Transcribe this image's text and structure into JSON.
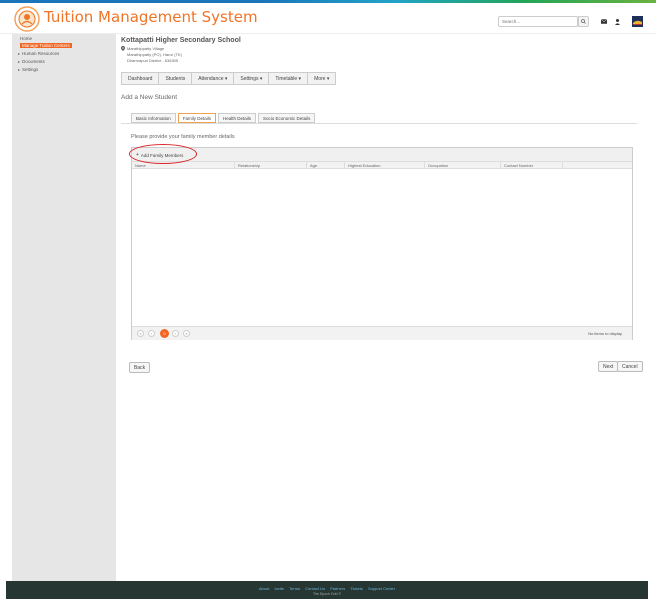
{
  "header": {
    "app_title": "Tuition Management System",
    "search_placeholder": "Search..."
  },
  "sidebar": {
    "items": [
      {
        "label": "Home"
      },
      {
        "label": "Manage Tuition Centers"
      },
      {
        "label": "Human Resources"
      },
      {
        "label": "Documents"
      },
      {
        "label": "Settings"
      }
    ]
  },
  "school": {
    "name": "Kottapatti Higher Secondary School",
    "address_line1": "Marathippatty Village",
    "address_line2": "Marathippatty (PO), Harur (TK)",
    "address_line3": "Dharmapuri District - 635305"
  },
  "nav": {
    "items": [
      {
        "label": "Dashboard"
      },
      {
        "label": "Students"
      },
      {
        "label": "Attendance ▾"
      },
      {
        "label": "Settings ▾"
      },
      {
        "label": "Timetable ▾"
      },
      {
        "label": "More ▾"
      }
    ]
  },
  "page": {
    "heading": "Add a New Student",
    "tabs": [
      {
        "label": "Basic Information"
      },
      {
        "label": "Family Details"
      },
      {
        "label": "Health Details"
      },
      {
        "label": "Socio Economic Details"
      }
    ],
    "instruction": "Please provide your family member details"
  },
  "grid": {
    "add_label": "Add Family Members",
    "columns": [
      "Name",
      "Relationship",
      "Age",
      "Highest Education",
      "Occupation",
      "Contact Number"
    ],
    "pager": {
      "first": "«",
      "prev": "‹",
      "current": "0",
      "next": "›",
      "last": "»",
      "info": "No items to display"
    }
  },
  "buttons": {
    "back": "Back",
    "next": "Next",
    "cancel": "Cancel"
  },
  "footer": {
    "links": [
      "About",
      "Invite",
      "Terms",
      "Contact Us",
      "Partners",
      "Tickets",
      "Support Center"
    ],
    "copyright": "The Epoch Grid ©"
  },
  "colors": {
    "accent": "#f26522",
    "title": "#f07427",
    "highlight_ring": "#d9252b",
    "footer_bg": "#263633"
  }
}
